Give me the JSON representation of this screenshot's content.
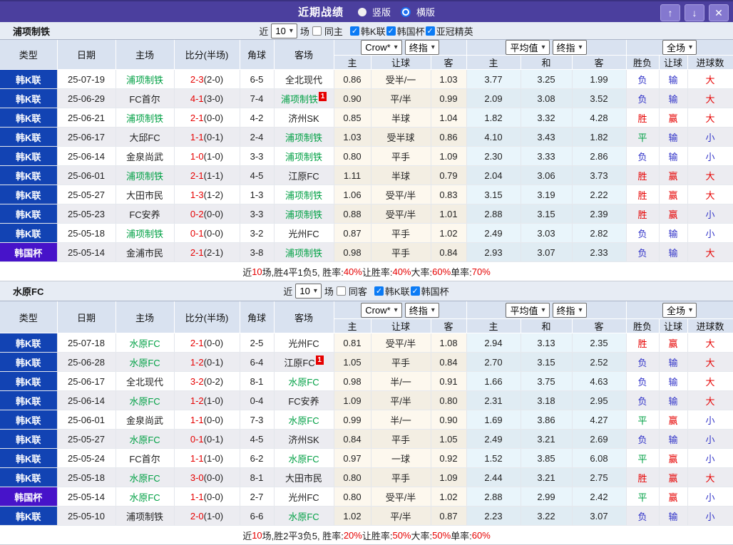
{
  "titlebar": {
    "title": "近期战绩",
    "radios": [
      {
        "label": "竖版",
        "checked": false
      },
      {
        "label": "横版",
        "checked": true
      }
    ],
    "buttons": [
      {
        "name": "move-up",
        "glyph": "↑"
      },
      {
        "name": "move-down",
        "glyph": "↓"
      },
      {
        "name": "close",
        "glyph": "✕"
      }
    ]
  },
  "colors": {
    "titlebar_bg": "#4b3f9e",
    "league_k_bg": "#1243b3",
    "league_cup_bg": "#4713c9",
    "team_green": "#00a044",
    "score_red": "#e60000",
    "result_blue": "#3032c8",
    "handicap_col_bg": "#fdf8ee",
    "avg_col_bg": "#e9f5fb"
  },
  "table_header": {
    "cols": [
      "类型",
      "日期",
      "主场",
      "比分(半场)",
      "角球",
      "客场"
    ],
    "sub": [
      "主",
      "让球",
      "客",
      "主",
      "和",
      "客",
      "胜负",
      "让球",
      "进球数"
    ],
    "sel_book": "Crow*",
    "sel_fin": "终指",
    "sel_avg": "平均值",
    "sel_scope": "全场"
  },
  "sections": [
    {
      "team": "浦项制铁",
      "filter": {
        "near": "近",
        "count": "10",
        "games": "场",
        "same": "同主",
        "same_checked": false,
        "leagues": [
          {
            "label": "韩K联",
            "checked": true
          },
          {
            "label": "韩国杯",
            "checked": true
          },
          {
            "label": "亚冠精英",
            "checked": true
          }
        ]
      },
      "rows": [
        {
          "type": "韩K联",
          "date": "25-07-19",
          "home": "浦项制铁",
          "hg": 1,
          "score": "2-3",
          "half": "(2-0)",
          "corner": "6-5",
          "away": "全北现代",
          "ah": [
            "0.86",
            "受半/一",
            "1.03"
          ],
          "eu": [
            "3.77",
            "3.25",
            "1.99"
          ],
          "res": [
            "负",
            "输",
            "大"
          ]
        },
        {
          "type": "韩K联",
          "date": "25-06-29",
          "home": "FC首尔",
          "score": "4-1",
          "half": "(3-0)",
          "corner": "7-4",
          "away": "浦项制铁",
          "ag": 1,
          "badge": "1",
          "ah": [
            "0.90",
            "平/半",
            "0.99"
          ],
          "eu": [
            "2.09",
            "3.08",
            "3.52"
          ],
          "res": [
            "负",
            "输",
            "大"
          ]
        },
        {
          "type": "韩K联",
          "date": "25-06-21",
          "home": "浦项制铁",
          "hg": 1,
          "score": "2-1",
          "half": "(0-0)",
          "corner": "4-2",
          "away": "济州SK",
          "ah": [
            "0.85",
            "半球",
            "1.04"
          ],
          "eu": [
            "1.82",
            "3.32",
            "4.28"
          ],
          "res": [
            "胜",
            "赢",
            "大"
          ]
        },
        {
          "type": "韩K联",
          "date": "25-06-17",
          "home": "大邱FC",
          "score": "1-1",
          "half": "(0-1)",
          "corner": "2-4",
          "away": "浦项制铁",
          "ag": 1,
          "ah": [
            "1.03",
            "受半球",
            "0.86"
          ],
          "eu": [
            "4.10",
            "3.43",
            "1.82"
          ],
          "res": [
            "平",
            "输",
            "小"
          ]
        },
        {
          "type": "韩K联",
          "date": "25-06-14",
          "home": "金泉尚武",
          "score": "1-0",
          "half": "(1-0)",
          "corner": "3-3",
          "away": "浦项制铁",
          "ag": 1,
          "ah": [
            "0.80",
            "平手",
            "1.09"
          ],
          "eu": [
            "2.30",
            "3.33",
            "2.86"
          ],
          "res": [
            "负",
            "输",
            "小"
          ]
        },
        {
          "type": "韩K联",
          "date": "25-06-01",
          "home": "浦项制铁",
          "hg": 1,
          "score": "2-1",
          "half": "(1-1)",
          "corner": "4-5",
          "away": "江原FC",
          "ah": [
            "1.11",
            "半球",
            "0.79"
          ],
          "eu": [
            "2.04",
            "3.06",
            "3.73"
          ],
          "res": [
            "胜",
            "赢",
            "大"
          ]
        },
        {
          "type": "韩K联",
          "date": "25-05-27",
          "home": "大田市民",
          "score": "1-3",
          "half": "(1-2)",
          "corner": "1-3",
          "away": "浦项制铁",
          "ag": 1,
          "ah": [
            "1.06",
            "受平/半",
            "0.83"
          ],
          "eu": [
            "3.15",
            "3.19",
            "2.22"
          ],
          "res": [
            "胜",
            "赢",
            "大"
          ]
        },
        {
          "type": "韩K联",
          "date": "25-05-23",
          "home": "FC安养",
          "score": "0-2",
          "half": "(0-0)",
          "corner": "3-3",
          "away": "浦项制铁",
          "ag": 1,
          "ah": [
            "0.88",
            "受平/半",
            "1.01"
          ],
          "eu": [
            "2.88",
            "3.15",
            "2.39"
          ],
          "res": [
            "胜",
            "赢",
            "小"
          ]
        },
        {
          "type": "韩K联",
          "date": "25-05-18",
          "home": "浦项制铁",
          "hg": 1,
          "score": "0-1",
          "half": "(0-0)",
          "corner": "3-2",
          "away": "光州FC",
          "ah": [
            "0.87",
            "平手",
            "1.02"
          ],
          "eu": [
            "2.49",
            "3.03",
            "2.82"
          ],
          "res": [
            "负",
            "输",
            "小"
          ]
        },
        {
          "type": "韩国杯",
          "cup": 1,
          "date": "25-05-14",
          "home": "金浦市民",
          "score": "2-1",
          "half": "(2-1)",
          "corner": "3-8",
          "away": "浦项制铁",
          "ag": 1,
          "ah": [
            "0.98",
            "平手",
            "0.84"
          ],
          "eu": [
            "2.93",
            "3.07",
            "2.33"
          ],
          "res": [
            "负",
            "输",
            "大"
          ]
        }
      ],
      "summary": [
        {
          "t": "近"
        },
        {
          "t": "10",
          "red": 1
        },
        {
          "t": "场,胜4平1负5, 胜率:"
        },
        {
          "t": "40%",
          "red": 1
        },
        {
          "t": " 让胜率:"
        },
        {
          "t": "40%",
          "red": 1
        },
        {
          "t": " 大率:"
        },
        {
          "t": "60%",
          "red": 1
        },
        {
          "t": " 单率:"
        },
        {
          "t": "70%",
          "red": 1
        }
      ]
    },
    {
      "team": "水原FC",
      "filter": {
        "near": "近",
        "count": "10",
        "games": "场",
        "same": "同客",
        "same_checked": false,
        "leagues": [
          {
            "label": "韩K联",
            "checked": true
          },
          {
            "label": "韩国杯",
            "checked": true
          }
        ]
      },
      "rows": [
        {
          "type": "韩K联",
          "date": "25-07-18",
          "home": "水原FC",
          "hg": 1,
          "score": "2-1",
          "half": "(0-0)",
          "corner": "2-5",
          "away": "光州FC",
          "ah": [
            "0.81",
            "受平/半",
            "1.08"
          ],
          "eu": [
            "2.94",
            "3.13",
            "2.35"
          ],
          "res": [
            "胜",
            "赢",
            "大"
          ]
        },
        {
          "type": "韩K联",
          "date": "25-06-28",
          "home": "水原FC",
          "hg": 1,
          "score": "1-2",
          "half": "(0-1)",
          "corner": "6-4",
          "away": "江原FC",
          "badge": "1",
          "ah": [
            "1.05",
            "平手",
            "0.84"
          ],
          "eu": [
            "2.70",
            "3.15",
            "2.52"
          ],
          "res": [
            "负",
            "输",
            "大"
          ]
        },
        {
          "type": "韩K联",
          "date": "25-06-17",
          "home": "全北现代",
          "score": "3-2",
          "half": "(0-2)",
          "corner": "8-1",
          "away": "水原FC",
          "ag": 1,
          "ah": [
            "0.98",
            "半/一",
            "0.91"
          ],
          "eu": [
            "1.66",
            "3.75",
            "4.63"
          ],
          "res": [
            "负",
            "输",
            "大"
          ]
        },
        {
          "type": "韩K联",
          "date": "25-06-14",
          "home": "水原FC",
          "hg": 1,
          "score": "1-2",
          "half": "(1-0)",
          "corner": "0-4",
          "away": "FC安养",
          "ah": [
            "1.09",
            "平/半",
            "0.80"
          ],
          "eu": [
            "2.31",
            "3.18",
            "2.95"
          ],
          "res": [
            "负",
            "输",
            "大"
          ]
        },
        {
          "type": "韩K联",
          "date": "25-06-01",
          "home": "金泉尚武",
          "score": "1-1",
          "half": "(0-0)",
          "corner": "7-3",
          "away": "水原FC",
          "ag": 1,
          "ah": [
            "0.99",
            "半/一",
            "0.90"
          ],
          "eu": [
            "1.69",
            "3.86",
            "4.27"
          ],
          "res": [
            "平",
            "赢",
            "小"
          ]
        },
        {
          "type": "韩K联",
          "date": "25-05-27",
          "home": "水原FC",
          "hg": 1,
          "score": "0-1",
          "half": "(0-1)",
          "corner": "4-5",
          "away": "济州SK",
          "ah": [
            "0.84",
            "平手",
            "1.05"
          ],
          "eu": [
            "2.49",
            "3.21",
            "2.69"
          ],
          "res": [
            "负",
            "输",
            "小"
          ]
        },
        {
          "type": "韩K联",
          "date": "25-05-24",
          "home": "FC首尔",
          "score": "1-1",
          "half": "(1-0)",
          "corner": "6-2",
          "away": "水原FC",
          "ag": 1,
          "ah": [
            "0.97",
            "一球",
            "0.92"
          ],
          "eu": [
            "1.52",
            "3.85",
            "6.08"
          ],
          "res": [
            "平",
            "赢",
            "小"
          ]
        },
        {
          "type": "韩K联",
          "date": "25-05-18",
          "home": "水原FC",
          "hg": 1,
          "score": "3-0",
          "half": "(0-0)",
          "corner": "8-1",
          "away": "大田市民",
          "ah": [
            "0.80",
            "平手",
            "1.09"
          ],
          "eu": [
            "2.44",
            "3.21",
            "2.75"
          ],
          "res": [
            "胜",
            "赢",
            "大"
          ]
        },
        {
          "type": "韩国杯",
          "cup": 1,
          "date": "25-05-14",
          "home": "水原FC",
          "hg": 1,
          "score": "1-1",
          "half": "(0-0)",
          "corner": "2-7",
          "away": "光州FC",
          "ah": [
            "0.80",
            "受平/半",
            "1.02"
          ],
          "eu": [
            "2.88",
            "2.99",
            "2.42"
          ],
          "res": [
            "平",
            "赢",
            "小"
          ]
        },
        {
          "type": "韩K联",
          "date": "25-05-10",
          "home": "浦项制铁",
          "score": "2-0",
          "half": "(1-0)",
          "corner": "6-6",
          "away": "水原FC",
          "ag": 1,
          "ah": [
            "1.02",
            "平/半",
            "0.87"
          ],
          "eu": [
            "2.23",
            "3.22",
            "3.07"
          ],
          "res": [
            "负",
            "输",
            "小"
          ]
        }
      ],
      "summary": [
        {
          "t": "近"
        },
        {
          "t": "10",
          "red": 1
        },
        {
          "t": "场,胜2平3负5, 胜率:"
        },
        {
          "t": "20%",
          "red": 1
        },
        {
          "t": " 让胜率:"
        },
        {
          "t": "50%",
          "red": 1
        },
        {
          "t": " 大率:"
        },
        {
          "t": "50%",
          "red": 1
        },
        {
          "t": " 单率:"
        },
        {
          "t": "60%",
          "red": 1
        }
      ]
    }
  ]
}
